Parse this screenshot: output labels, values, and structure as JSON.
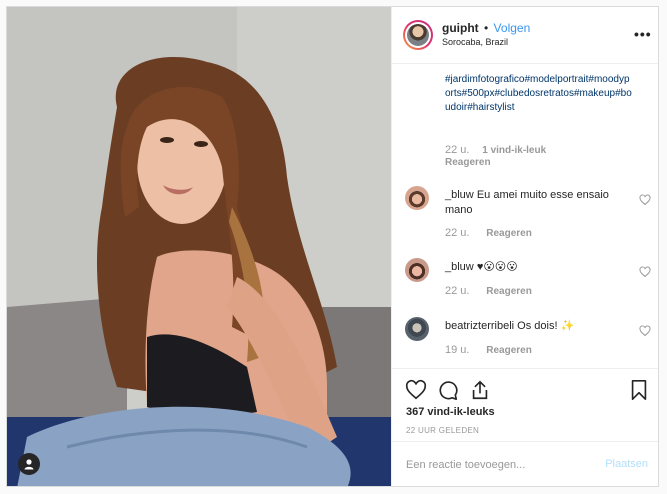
{
  "header": {
    "username": "guipht",
    "separator": "•",
    "follow_label": "Volgen",
    "location": "Sorocaba, Brazil"
  },
  "caption": {
    "hashtags": "#jardimfotografico#modelportrait#moodyports#500px#clubedosretratos#makeup#boudoir#hairstylist",
    "time": "22 u.",
    "likes": "1 vind-ik-leuk",
    "reply": "Reageren"
  },
  "comments": [
    {
      "user": "_bluw",
      "text": "Eu amei muito esse ensaio mano",
      "time": "22 u.",
      "reply": "Reageren"
    },
    {
      "user": "_bluw",
      "text": "♥😮😮😮",
      "time": "22 u.",
      "reply": "Reageren"
    },
    {
      "user": "beatrizterribeli",
      "text": "Os dois! ✨",
      "time": "19 u.",
      "reply": "Reageren"
    }
  ],
  "actions": {
    "like_count": "367 vind-ik-leuks",
    "timestamp": "22 UUR GELEDEN"
  },
  "comment_box": {
    "placeholder": "Een reactie toevoegen...",
    "post_label": "Plaatsen"
  },
  "colors": {
    "accent": "#3897f0",
    "post_disabled": "#b2dffc",
    "hashtag": "#003569",
    "muted": "#999999"
  },
  "icons": [
    "more-icon",
    "tag-user-icon",
    "heart-icon",
    "comment-icon",
    "share-icon",
    "bookmark-icon",
    "small-heart-icon"
  ]
}
